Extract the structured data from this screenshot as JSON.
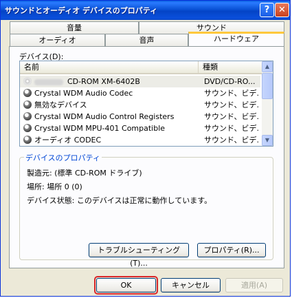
{
  "window": {
    "title": "サウンドとオーディオ デバイスのプロパティ",
    "help_symbol": "?",
    "close_symbol": "✕"
  },
  "tabs": {
    "top": [
      "音量",
      "サウンド"
    ],
    "bottom": [
      "オーディオ",
      "音声",
      "ハードウェア"
    ],
    "active": "ハードウェア"
  },
  "devices": {
    "label": "デバイス(D):",
    "columns": [
      "名前",
      "種類"
    ],
    "rows": [
      {
        "name": "CD-ROM XM-6402B",
        "type": "DVD/CD-RO...",
        "icon": "cd-drive-icon",
        "selected": true
      },
      {
        "name": "Crystal WDM Audio Codec",
        "type": "サウンド、ビデ...",
        "icon": "speaker-icon"
      },
      {
        "name": "無効なデバイス",
        "type": "サウンド、ビデ...",
        "icon": "speaker-icon"
      },
      {
        "name": "Crystal WDM Audio Control Registers",
        "type": "サウンド、ビデ...",
        "icon": "speaker-icon"
      },
      {
        "name": "Crystal WDM MPU-401 Compatible",
        "type": "サウンド、ビデ...",
        "icon": "speaker-icon"
      },
      {
        "name": "オーディオ CODEC",
        "type": "サウンド、ビデ...",
        "icon": "speaker-icon"
      }
    ]
  },
  "properties": {
    "legend": "デバイスのプロパティ",
    "manufacturer": "製造元: (標準 CD-ROM ドライブ)",
    "location": "場所: 場所 0 (0)",
    "status": "デバイス状態: このデバイスは正常に動作しています。",
    "troubleshoot_label": "トラブルシューティング(T)...",
    "properties_label": "プロパティ(R)..."
  },
  "footer": {
    "ok": "OK",
    "cancel": "キャンセル",
    "apply": "適用(A)"
  },
  "colors": {
    "titlebar": "#0a52d6",
    "highlight_ring": "#d8272a",
    "active_tab_accent": "#ffc83c"
  }
}
